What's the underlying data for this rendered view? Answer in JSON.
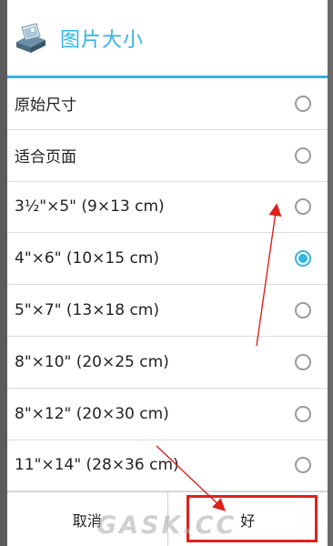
{
  "dialog": {
    "title": "图片大小",
    "icon": "printer-photo-icon",
    "accent_color": "#33b5e5"
  },
  "options": [
    {
      "label": "原始尺寸",
      "selected": false
    },
    {
      "label": "适合页面",
      "selected": false
    },
    {
      "label": "3½\"×5\" (9×13 cm)",
      "selected": false
    },
    {
      "label": "4\"×6\" (10×15 cm)",
      "selected": true
    },
    {
      "label": "5\"×7\" (13×18 cm)",
      "selected": false
    },
    {
      "label": "8\"×10\" (20×25 cm)",
      "selected": false
    },
    {
      "label": "8\"×12\" (20×30 cm)",
      "selected": false
    },
    {
      "label": "11\"×14\" (28×36 cm)",
      "selected": false
    }
  ],
  "buttons": {
    "cancel_label": "取消",
    "ok_label": "好"
  },
  "annotation_color": "#e0201b",
  "watermark": "GASK.CC"
}
